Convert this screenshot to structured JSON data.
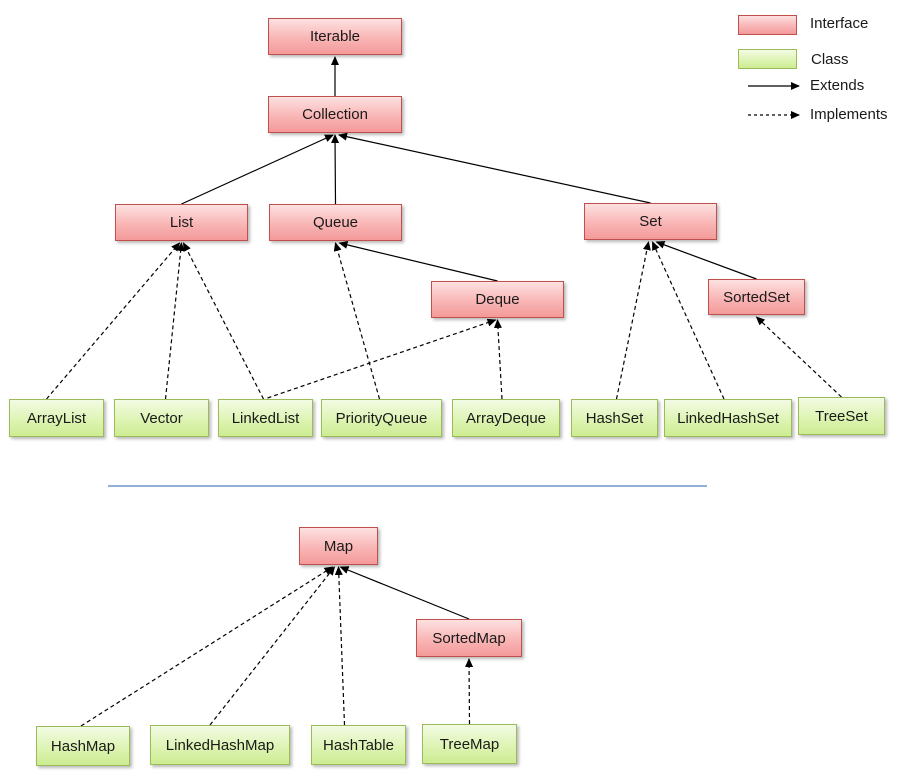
{
  "legend": {
    "interface_label": "Interface",
    "class_label": "Class",
    "extends_label": "Extends",
    "implements_label": "Implements"
  },
  "colors": {
    "interface_border": "#c0504d",
    "class_border": "#9bbb59",
    "separator": "#4f81bd",
    "arrow": "#000000"
  },
  "nodes": {
    "iterable": {
      "label": "Iterable",
      "kind": "interface"
    },
    "collection": {
      "label": "Collection",
      "kind": "interface"
    },
    "list": {
      "label": "List",
      "kind": "interface"
    },
    "queue": {
      "label": "Queue",
      "kind": "interface"
    },
    "set": {
      "label": "Set",
      "kind": "interface"
    },
    "deque": {
      "label": "Deque",
      "kind": "interface"
    },
    "sortedset": {
      "label": "SortedSet",
      "kind": "interface"
    },
    "arraylist": {
      "label": "ArrayList",
      "kind": "class"
    },
    "vector": {
      "label": "Vector",
      "kind": "class"
    },
    "linkedlist": {
      "label": "LinkedList",
      "kind": "class"
    },
    "priorityqueue": {
      "label": "PriorityQueue",
      "kind": "class"
    },
    "arraydeque": {
      "label": "ArrayDeque",
      "kind": "class"
    },
    "hashset": {
      "label": "HashSet",
      "kind": "class"
    },
    "linkedhashset": {
      "label": "LinkedHashSet",
      "kind": "class"
    },
    "treeset": {
      "label": "TreeSet",
      "kind": "class"
    },
    "map": {
      "label": "Map",
      "kind": "interface"
    },
    "sortedmap": {
      "label": "SortedMap",
      "kind": "interface"
    },
    "hashmap": {
      "label": "HashMap",
      "kind": "class"
    },
    "linkedhashmap": {
      "label": "LinkedHashMap",
      "kind": "class"
    },
    "hashtable": {
      "label": "HashTable",
      "kind": "class"
    },
    "treemap": {
      "label": "TreeMap",
      "kind": "class"
    }
  },
  "edges": [
    {
      "from": "collection",
      "to": "iterable",
      "type": "extends"
    },
    {
      "from": "list",
      "to": "collection",
      "type": "extends"
    },
    {
      "from": "queue",
      "to": "collection",
      "type": "extends"
    },
    {
      "from": "set",
      "to": "collection",
      "type": "extends"
    },
    {
      "from": "deque",
      "to": "queue",
      "type": "extends"
    },
    {
      "from": "sortedset",
      "to": "set",
      "type": "extends"
    },
    {
      "from": "arraylist",
      "to": "list",
      "type": "implements"
    },
    {
      "from": "vector",
      "to": "list",
      "type": "implements"
    },
    {
      "from": "linkedlist",
      "to": "list",
      "type": "implements"
    },
    {
      "from": "linkedlist",
      "to": "deque",
      "type": "implements"
    },
    {
      "from": "priorityqueue",
      "to": "queue",
      "type": "implements"
    },
    {
      "from": "arraydeque",
      "to": "deque",
      "type": "implements"
    },
    {
      "from": "hashset",
      "to": "set",
      "type": "implements"
    },
    {
      "from": "linkedhashset",
      "to": "set",
      "type": "implements"
    },
    {
      "from": "treeset",
      "to": "sortedset",
      "type": "implements"
    },
    {
      "from": "sortedmap",
      "to": "map",
      "type": "extends"
    },
    {
      "from": "hashmap",
      "to": "map",
      "type": "implements"
    },
    {
      "from": "linkedhashmap",
      "to": "map",
      "type": "implements"
    },
    {
      "from": "hashtable",
      "to": "map",
      "type": "implements"
    },
    {
      "from": "treemap",
      "to": "sortedmap",
      "type": "implements"
    }
  ]
}
